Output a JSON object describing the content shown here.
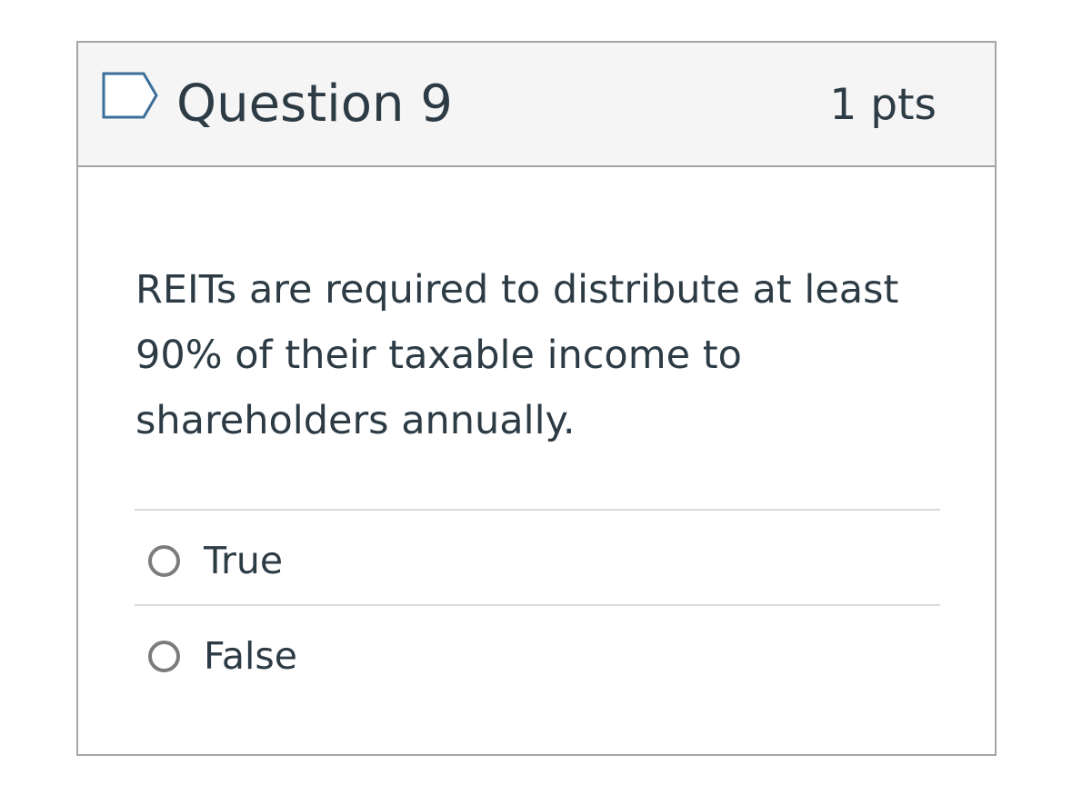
{
  "question": {
    "title": "Question 9",
    "points": "1 pts",
    "flag_icon": "flag-icon",
    "text": "REITs are required to distribute at least 90% of their taxable income to shareholders annually."
  },
  "answers": [
    {
      "label": "True",
      "selected": false
    },
    {
      "label": "False",
      "selected": false
    }
  ],
  "colors": {
    "header_background": "#f5f5f5",
    "border": "#a5a5a5",
    "text": "#2d3b45",
    "flag_outline": "#3b6e99",
    "radio_border": "#7c7c7c",
    "divider": "#d9d9d9"
  }
}
